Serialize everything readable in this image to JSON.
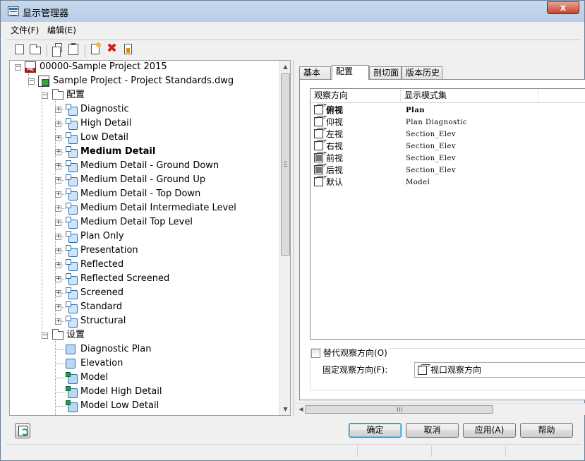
{
  "window": {
    "title": "显示管理器",
    "close_glyph": "x"
  },
  "menu": [
    {
      "label": "文件(F)"
    },
    {
      "label": "编辑(E)"
    }
  ],
  "toolbar": {
    "buttons": [
      "new-icon",
      "open-icon",
      "copy-icon",
      "paste-icon",
      "new-doc-icon",
      "delete-icon",
      "purge-icon"
    ]
  },
  "tree": {
    "root": "00000-Sample Project 2015",
    "drawing": "Sample Project - Project Standards.dwg",
    "configs_folder": "配置",
    "configs": [
      {
        "label": "Diagnostic",
        "bold": false
      },
      {
        "label": "High Detail",
        "bold": false
      },
      {
        "label": "Low Detail",
        "bold": false
      },
      {
        "label": "Medium Detail",
        "bold": true
      },
      {
        "label": "Medium Detail - Ground Down",
        "bold": false
      },
      {
        "label": "Medium Detail - Ground Up",
        "bold": false
      },
      {
        "label": "Medium Detail - Top Down",
        "bold": false
      },
      {
        "label": "Medium Detail Intermediate Level",
        "bold": false
      },
      {
        "label": "Medium Detail Top Level",
        "bold": false
      },
      {
        "label": "Plan Only",
        "bold": false
      },
      {
        "label": "Presentation",
        "bold": false
      },
      {
        "label": "Reflected",
        "bold": false
      },
      {
        "label": "Reflected Screened",
        "bold": false
      },
      {
        "label": "Screened",
        "bold": false
      },
      {
        "label": "Standard",
        "bold": false
      },
      {
        "label": "Structural",
        "bold": false
      }
    ],
    "sets_folder": "设置",
    "sets": [
      {
        "label": "Diagnostic Plan",
        "icon": "set"
      },
      {
        "label": "Elevation",
        "icon": "set"
      },
      {
        "label": "Model",
        "icon": "model"
      },
      {
        "label": "Model High Detail",
        "icon": "model"
      },
      {
        "label": "Model Low Detail",
        "icon": "model"
      }
    ]
  },
  "tabs": [
    {
      "label": "基本",
      "active": false
    },
    {
      "label": "配置",
      "active": true
    },
    {
      "label": "剖切面",
      "active": false
    },
    {
      "label": "版本历史",
      "active": false
    }
  ],
  "views": {
    "col_view": "观察方向",
    "col_set": "显示模式集",
    "rows": [
      {
        "view": "俯视",
        "set": "Plan",
        "bold": true,
        "dark": false
      },
      {
        "view": "仰视",
        "set": "Plan Diagnostic",
        "bold": false,
        "dark": false
      },
      {
        "view": "左视",
        "set": "Section_Elev",
        "bold": false,
        "dark": false
      },
      {
        "view": "右视",
        "set": "Section_Elev",
        "bold": false,
        "dark": false
      },
      {
        "view": "前视",
        "set": "Section_Elev",
        "bold": false,
        "dark": true
      },
      {
        "view": "后视",
        "set": "Section_Elev",
        "bold": false,
        "dark": true
      },
      {
        "view": "默认",
        "set": "Model",
        "bold": false,
        "dark": false
      }
    ]
  },
  "override": {
    "checkbox_label": "替代观察方向(O)",
    "checked": false,
    "fixed_label": "固定观察方向(F):",
    "fixed_value": "视口观察方向"
  },
  "buttons": {
    "ok": "确定",
    "cancel": "取消",
    "apply": "应用(A)",
    "help": "帮助"
  }
}
